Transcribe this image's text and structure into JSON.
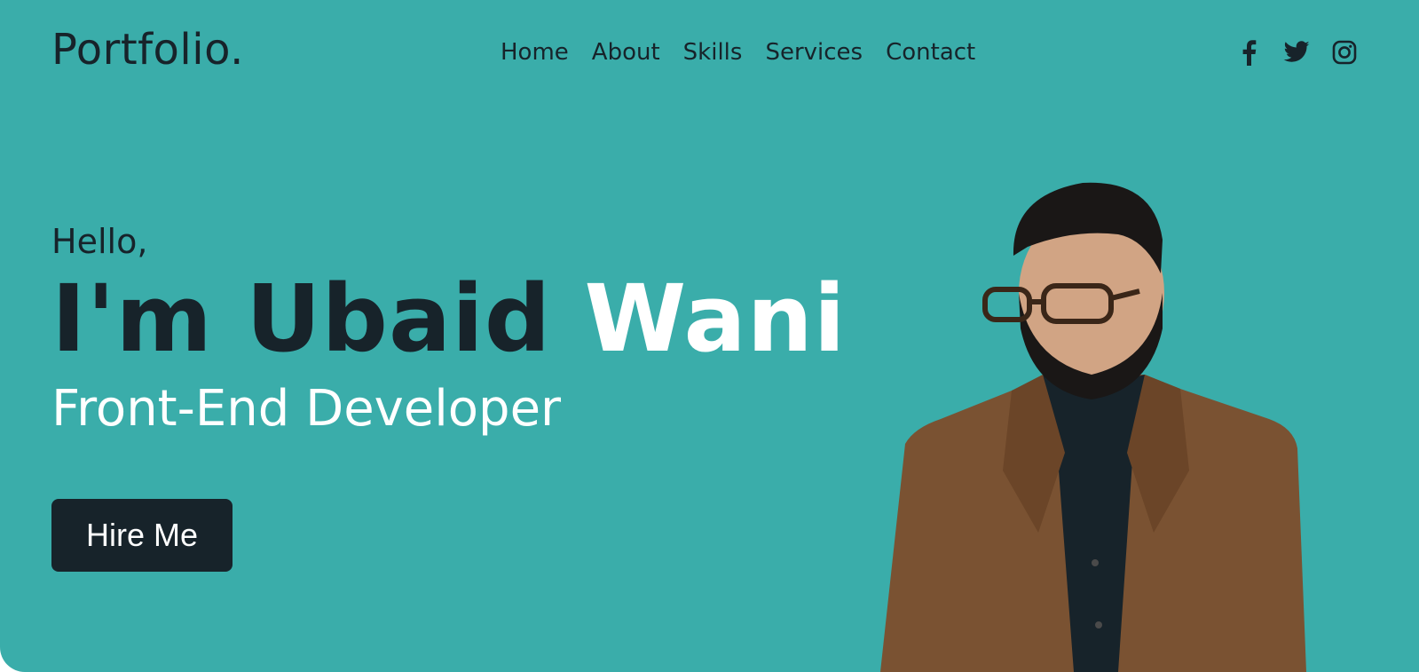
{
  "header": {
    "logo": "Portfolio."
  },
  "nav": {
    "items": [
      {
        "label": "Home"
      },
      {
        "label": "About"
      },
      {
        "label": "Skills"
      },
      {
        "label": "Services"
      },
      {
        "label": "Contact"
      }
    ]
  },
  "social": {
    "icons": [
      "facebook-icon",
      "twitter-icon",
      "instagram-icon"
    ]
  },
  "hero": {
    "greeting": "Hello,",
    "name_first": "I'm Ubaid",
    "name_last": "Wani",
    "role": "Front-End Developer",
    "cta_label": "Hire Me"
  },
  "colors": {
    "background": "#3aadaa",
    "text_dark": "#17232a",
    "accent_text": "#ffffff",
    "button_bg": "#17232a"
  }
}
